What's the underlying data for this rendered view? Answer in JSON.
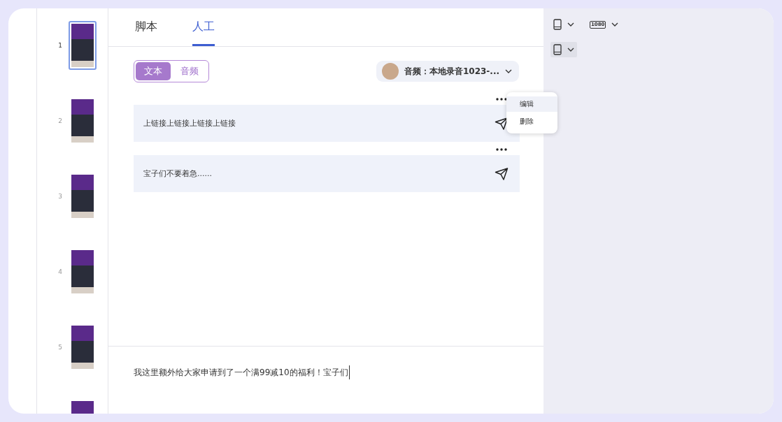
{
  "slides": [
    {
      "number": "1",
      "selected": true
    },
    {
      "number": "2",
      "selected": false
    },
    {
      "number": "3",
      "selected": false
    },
    {
      "number": "4",
      "selected": false
    },
    {
      "number": "5",
      "selected": false
    },
    {
      "selected": false
    }
  ],
  "tabs": [
    {
      "label": "脚本",
      "selected": false
    },
    {
      "label": "人工",
      "selected": true
    }
  ],
  "mode_toggle": [
    {
      "label": "文本",
      "selected": true
    },
    {
      "label": "音频",
      "selected": false
    }
  ],
  "audio_select": {
    "value": "音频：本地录音1023-..."
  },
  "messages": [
    {
      "text": "上链接上链接上链接上链接",
      "menu_open": true
    },
    {
      "text": "宝子们不要着急......",
      "menu_open": false
    }
  ],
  "context_menu": {
    "items": [
      {
        "label": "编辑",
        "selected": true
      },
      {
        "label": "删除",
        "selected": false
      }
    ]
  },
  "input": {
    "value": "我这里额外给大家申请到了一个满99减10的福利！宝子们"
  },
  "toolbar": {
    "resolution": "1080",
    "layout_selected": true
  }
}
